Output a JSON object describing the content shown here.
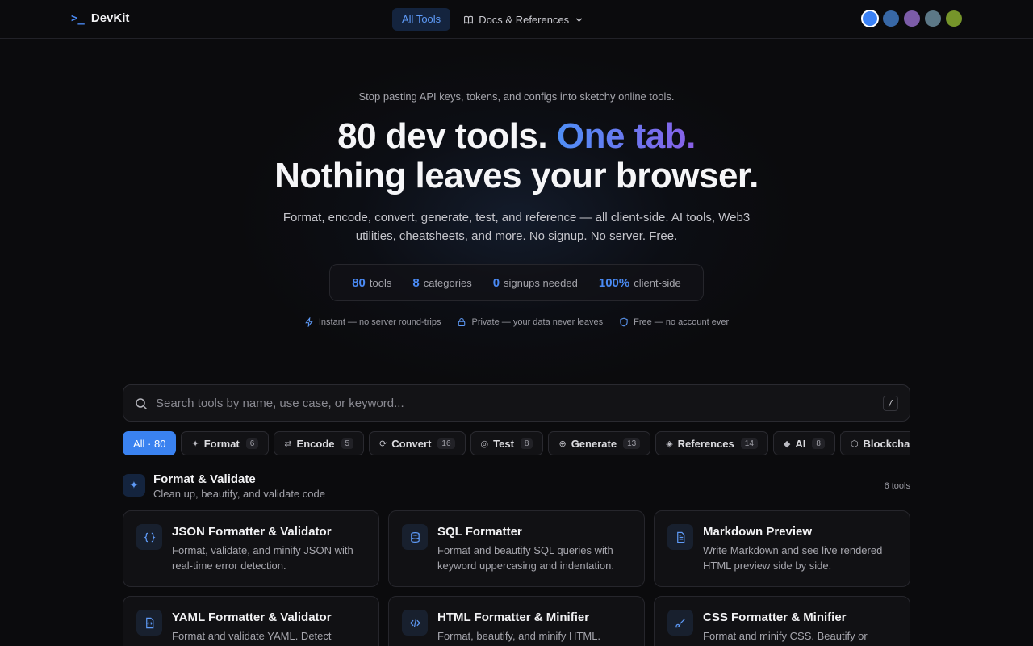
{
  "brand": {
    "name": "DevKit",
    "icon": "terminal-prompt-icon",
    "glyph": ">_"
  },
  "nav": {
    "all_tools": "All Tools",
    "docs": "Docs & References",
    "docs_icon": "book-icon"
  },
  "themes": [
    {
      "color": "#3b82f6",
      "selected": true
    },
    {
      "color": "#3868a6"
    },
    {
      "color": "#7c5ca8"
    },
    {
      "color": "#5c7887"
    },
    {
      "color": "#76952a"
    }
  ],
  "hero": {
    "tagline": "Stop pasting API keys, tokens, and configs into sketchy online tools.",
    "headline_part1": "80 dev tools. ",
    "headline_accent": "One tab.",
    "headline_line2": "Nothing leaves your browser.",
    "subtext": "Format, encode, convert, generate, test, and reference — all client-side. AI tools, Web3 utilities, cheatsheets, and more. No signup. No server. Free."
  },
  "stats": [
    {
      "value": "80",
      "label": "tools"
    },
    {
      "value": "8",
      "label": "categories"
    },
    {
      "value": "0",
      "label": "signups needed"
    },
    {
      "value": "100%",
      "label": "client-side"
    }
  ],
  "features": [
    {
      "icon": "lightning-icon",
      "text": "Instant — no server round-trips"
    },
    {
      "icon": "lock-icon",
      "text": "Private — your data never leaves"
    },
    {
      "icon": "shield-icon",
      "text": "Free — no account ever"
    }
  ],
  "search": {
    "placeholder": "Search tools by name, use case, or keyword...",
    "shortcut": "/"
  },
  "categories": [
    {
      "label": "All · 80",
      "active": true
    },
    {
      "icon": "✦",
      "label": "Format",
      "count": "6"
    },
    {
      "icon": "⇄",
      "label": "Encode",
      "count": "5"
    },
    {
      "icon": "⟳",
      "label": "Convert",
      "count": "16"
    },
    {
      "icon": "◎",
      "label": "Test",
      "count": "8"
    },
    {
      "icon": "⊕",
      "label": "Generate",
      "count": "13"
    },
    {
      "icon": "◈",
      "label": "References",
      "count": "14"
    },
    {
      "icon": "◆",
      "label": "AI",
      "count": "8"
    },
    {
      "icon": "⬡",
      "label": "Blockchain",
      "count": ""
    }
  ],
  "section": {
    "icon": "✦",
    "title": "Format & Validate",
    "subtitle": "Clean up, beautify, and validate code",
    "count": "6 tools"
  },
  "tools": [
    {
      "icon": "braces-icon",
      "title": "JSON Formatter & Validator",
      "desc": "Format, validate, and minify JSON with real-time error detection."
    },
    {
      "icon": "database-icon",
      "title": "SQL Formatter",
      "desc": "Format and beautify SQL queries with keyword uppercasing and indentation."
    },
    {
      "icon": "document-icon",
      "title": "Markdown Preview",
      "desc": "Write Markdown and see live rendered HTML preview side by side."
    },
    {
      "icon": "yaml-file-icon",
      "title": "YAML Formatter & Validator",
      "desc": "Format and validate YAML. Detect syntax errors and convert to JSON."
    },
    {
      "icon": "code-icon",
      "title": "HTML Formatter & Minifier",
      "desc": "Format, beautify, and minify HTML. Auto-indent tags and attributes."
    },
    {
      "icon": "brush-icon",
      "title": "CSS Formatter & Minifier",
      "desc": "Format and minify CSS. Beautify or compress stylesheets in one click."
    }
  ]
}
